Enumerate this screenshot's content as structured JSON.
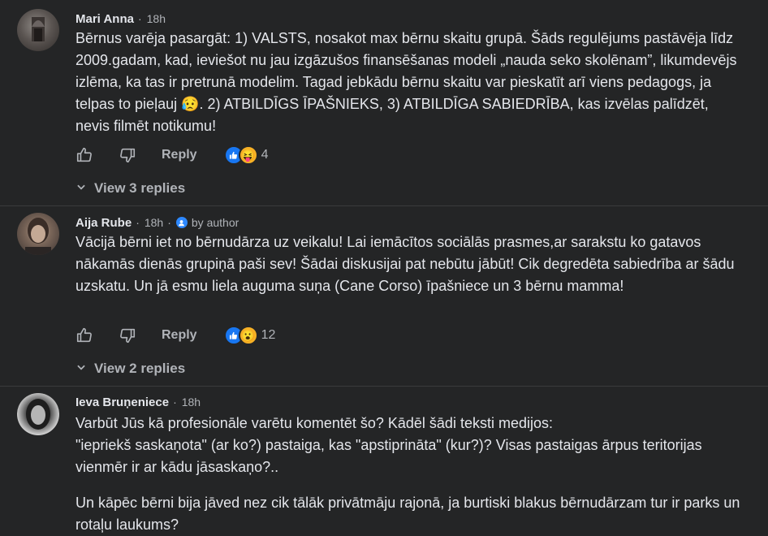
{
  "comments": [
    {
      "name": "Mari Anna",
      "time": "18h",
      "author_label": "",
      "paragraphs": [
        "Bērnus varēja pasargāt: 1) VALSTS, nosakot max bērnu skaitu grupā. Šāds regulējums pastāvēja līdz 2009.gadam, kad, ieviešot nu jau izgāzušos finansēšanas modeli „nauda seko skolēnam”, likumdevējs izlēma, ka tas ir pretrunā modelim. Tagad jebkādu bērnu skaitu var pieskatīt arī viens pedagogs, ja telpas to pieļauj 😥. 2) ATBILDĪGS ĪPAŠNIEKS, 3) ATBILDĪGA SABIEDRĪBA, kas izvēlas palīdzēt, nevis filmēt notikumu!"
      ],
      "reply_label": "Reply",
      "reaction_count": "4",
      "reaction_emoji": "😝",
      "view_replies": "View 3 replies"
    },
    {
      "name": "Aija Rube",
      "time": "18h",
      "author_label": "by author",
      "paragraphs": [
        "Vācijā bērni iet no bērnudārza uz veikalu! Lai iemācītos sociālās prasmes,ar sarakstu ko gatavos nākamās dienās grupiņā paši sev! Šādai diskusijai pat nebūtu jābūt! Cik degredēta sabiedrība ar šādu uzskatu. Un jā esmu liela auguma suņa (Cane Corso) īpašniece un 3 bērnu mamma!"
      ],
      "reply_label": "Reply",
      "reaction_count": "12",
      "reaction_emoji": "😮",
      "view_replies": "View 2 replies"
    },
    {
      "name": "Ieva Bruņeniece",
      "time": "18h",
      "author_label": "",
      "paragraphs": [
        "Varbūt Jūs kā profesionāle varētu komentēt šo? Kādēl šādi teksti medijos:",
        "\"iepriekš saskaņota\" (ar ko?) pastaiga, kas \"apstiprināta\" (kur?)? Visas pastaigas ārpus teritorijas vienmēr ir ar kādu jāsaskaņo?..",
        "Un kāpēc bērni bija jāved nez cik tālāk privātmāju rajonā, ja burtiski blakus bērnudārzam tur ir parks un rotaļu laukums?"
      ]
    }
  ],
  "colors": {
    "background": "#242526",
    "text": "#e4e6eb",
    "secondary": "#b0b3b8",
    "like_blue": "#1877f2"
  },
  "icons": [
    "like-icon",
    "dislike-icon",
    "chevron-down-icon",
    "author-badge-icon"
  ]
}
